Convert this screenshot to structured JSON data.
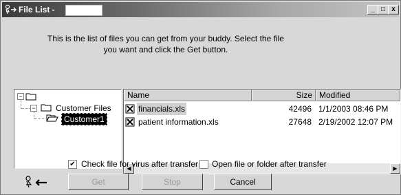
{
  "window": {
    "title": "File List -",
    "buddy_name": "",
    "minimize_label": "_",
    "maximize_label": "□",
    "close_label": "x"
  },
  "instructions": "This is the list of files you can get from your buddy.  Select the file you want and click the Get button.",
  "tree": {
    "customer_files_label": "Customer Files",
    "customer_label": "Customer1",
    "root_expander": "−",
    "child_expander": "−"
  },
  "file_list": {
    "columns": {
      "name": "Name",
      "size": "Size",
      "modified": "Modified"
    },
    "rows": [
      {
        "name": "financials.xls",
        "size": "42496",
        "modified": "1/1/2003 08:46 PM"
      },
      {
        "name": "patient information.xls",
        "size": "27648",
        "modified": "2/19/2002 12:07 PM"
      }
    ]
  },
  "options": {
    "virus_check": {
      "label": "Check file for virus after transfer",
      "checked": true,
      "mark": "✔"
    },
    "open_after": {
      "label": "Open file or folder after transfer",
      "checked": false
    }
  },
  "buttons": {
    "get": "Get",
    "stop": "Stop",
    "cancel": "Cancel"
  },
  "colors": {
    "title_dark": "#3a3a3a",
    "title_light": "#c4c4c4",
    "dialog_bg": "#d8d8d8",
    "selection_bg": "#000000"
  }
}
